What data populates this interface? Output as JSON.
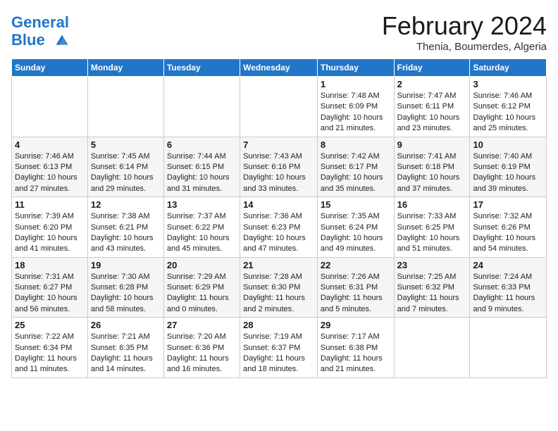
{
  "header": {
    "logo_line1": "General",
    "logo_line2": "Blue",
    "title": "February 2024",
    "subtitle": "Thenia, Boumerdes, Algeria"
  },
  "days_of_week": [
    "Sunday",
    "Monday",
    "Tuesday",
    "Wednesday",
    "Thursday",
    "Friday",
    "Saturday"
  ],
  "weeks": [
    [
      {
        "day": "",
        "info": ""
      },
      {
        "day": "",
        "info": ""
      },
      {
        "day": "",
        "info": ""
      },
      {
        "day": "",
        "info": ""
      },
      {
        "day": "1",
        "info": "Sunrise: 7:48 AM\nSunset: 6:09 PM\nDaylight: 10 hours and 21 minutes."
      },
      {
        "day": "2",
        "info": "Sunrise: 7:47 AM\nSunset: 6:11 PM\nDaylight: 10 hours and 23 minutes."
      },
      {
        "day": "3",
        "info": "Sunrise: 7:46 AM\nSunset: 6:12 PM\nDaylight: 10 hours and 25 minutes."
      }
    ],
    [
      {
        "day": "4",
        "info": "Sunrise: 7:46 AM\nSunset: 6:13 PM\nDaylight: 10 hours and 27 minutes."
      },
      {
        "day": "5",
        "info": "Sunrise: 7:45 AM\nSunset: 6:14 PM\nDaylight: 10 hours and 29 minutes."
      },
      {
        "day": "6",
        "info": "Sunrise: 7:44 AM\nSunset: 6:15 PM\nDaylight: 10 hours and 31 minutes."
      },
      {
        "day": "7",
        "info": "Sunrise: 7:43 AM\nSunset: 6:16 PM\nDaylight: 10 hours and 33 minutes."
      },
      {
        "day": "8",
        "info": "Sunrise: 7:42 AM\nSunset: 6:17 PM\nDaylight: 10 hours and 35 minutes."
      },
      {
        "day": "9",
        "info": "Sunrise: 7:41 AM\nSunset: 6:18 PM\nDaylight: 10 hours and 37 minutes."
      },
      {
        "day": "10",
        "info": "Sunrise: 7:40 AM\nSunset: 6:19 PM\nDaylight: 10 hours and 39 minutes."
      }
    ],
    [
      {
        "day": "11",
        "info": "Sunrise: 7:39 AM\nSunset: 6:20 PM\nDaylight: 10 hours and 41 minutes."
      },
      {
        "day": "12",
        "info": "Sunrise: 7:38 AM\nSunset: 6:21 PM\nDaylight: 10 hours and 43 minutes."
      },
      {
        "day": "13",
        "info": "Sunrise: 7:37 AM\nSunset: 6:22 PM\nDaylight: 10 hours and 45 minutes."
      },
      {
        "day": "14",
        "info": "Sunrise: 7:36 AM\nSunset: 6:23 PM\nDaylight: 10 hours and 47 minutes."
      },
      {
        "day": "15",
        "info": "Sunrise: 7:35 AM\nSunset: 6:24 PM\nDaylight: 10 hours and 49 minutes."
      },
      {
        "day": "16",
        "info": "Sunrise: 7:33 AM\nSunset: 6:25 PM\nDaylight: 10 hours and 51 minutes."
      },
      {
        "day": "17",
        "info": "Sunrise: 7:32 AM\nSunset: 6:26 PM\nDaylight: 10 hours and 54 minutes."
      }
    ],
    [
      {
        "day": "18",
        "info": "Sunrise: 7:31 AM\nSunset: 6:27 PM\nDaylight: 10 hours and 56 minutes."
      },
      {
        "day": "19",
        "info": "Sunrise: 7:30 AM\nSunset: 6:28 PM\nDaylight: 10 hours and 58 minutes."
      },
      {
        "day": "20",
        "info": "Sunrise: 7:29 AM\nSunset: 6:29 PM\nDaylight: 11 hours and 0 minutes."
      },
      {
        "day": "21",
        "info": "Sunrise: 7:28 AM\nSunset: 6:30 PM\nDaylight: 11 hours and 2 minutes."
      },
      {
        "day": "22",
        "info": "Sunrise: 7:26 AM\nSunset: 6:31 PM\nDaylight: 11 hours and 5 minutes."
      },
      {
        "day": "23",
        "info": "Sunrise: 7:25 AM\nSunset: 6:32 PM\nDaylight: 11 hours and 7 minutes."
      },
      {
        "day": "24",
        "info": "Sunrise: 7:24 AM\nSunset: 6:33 PM\nDaylight: 11 hours and 9 minutes."
      }
    ],
    [
      {
        "day": "25",
        "info": "Sunrise: 7:22 AM\nSunset: 6:34 PM\nDaylight: 11 hours and 11 minutes."
      },
      {
        "day": "26",
        "info": "Sunrise: 7:21 AM\nSunset: 6:35 PM\nDaylight: 11 hours and 14 minutes."
      },
      {
        "day": "27",
        "info": "Sunrise: 7:20 AM\nSunset: 6:36 PM\nDaylight: 11 hours and 16 minutes."
      },
      {
        "day": "28",
        "info": "Sunrise: 7:19 AM\nSunset: 6:37 PM\nDaylight: 11 hours and 18 minutes."
      },
      {
        "day": "29",
        "info": "Sunrise: 7:17 AM\nSunset: 6:38 PM\nDaylight: 11 hours and 21 minutes."
      },
      {
        "day": "",
        "info": ""
      },
      {
        "day": "",
        "info": ""
      }
    ]
  ]
}
